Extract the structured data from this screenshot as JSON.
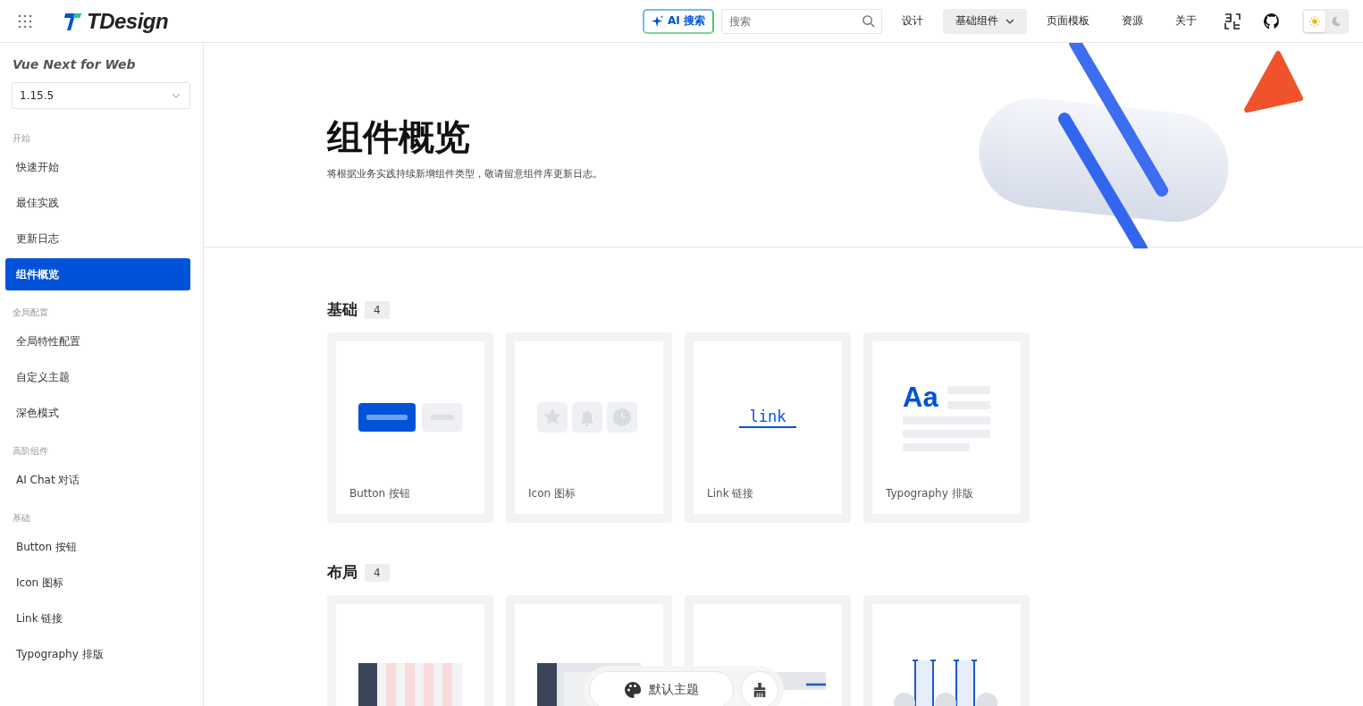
{
  "header": {
    "logo": "TDesign",
    "ai_search": "AI 搜索",
    "search": {
      "placeholder": "搜索"
    },
    "nav": [
      {
        "label": "设计",
        "selected": false,
        "dropdown": false
      },
      {
        "label": "基础组件",
        "selected": true,
        "dropdown": true
      },
      {
        "label": "页面模板",
        "selected": false,
        "dropdown": false
      },
      {
        "label": "资源",
        "selected": false,
        "dropdown": false
      },
      {
        "label": "关于",
        "selected": false,
        "dropdown": false
      }
    ],
    "theme_modes": [
      {
        "kind": "light",
        "selected": true
      },
      {
        "kind": "dark",
        "selected": false
      }
    ]
  },
  "sidebar": {
    "title": "Vue Next for Web",
    "version": "1.15.5",
    "groups": [
      {
        "title": "开始",
        "items": [
          {
            "label": "快速开始",
            "selected": false
          },
          {
            "label": "最佳实践",
            "selected": false
          },
          {
            "label": "更新日志",
            "selected": false
          },
          {
            "label": "组件概览",
            "selected": true
          }
        ]
      },
      {
        "title": "全局配置",
        "items": [
          {
            "label": "全局特性配置",
            "selected": false
          },
          {
            "label": "自定义主题",
            "selected": false
          },
          {
            "label": "深色模式",
            "selected": false
          }
        ]
      },
      {
        "title": "高阶组件",
        "items": [
          {
            "label": "AI Chat 对话",
            "selected": false
          }
        ]
      },
      {
        "title": "基础",
        "items": [
          {
            "label": "Button 按钮",
            "selected": false
          },
          {
            "label": "Icon 图标",
            "selected": false
          },
          {
            "label": "Link 链接",
            "selected": false
          },
          {
            "label": "Typography 排版",
            "selected": false
          }
        ]
      }
    ]
  },
  "hero": {
    "title": "组件概览",
    "subtitle": "将根据业务实践持续新增组件类型，敬请留意组件库更新日志。"
  },
  "sections": [
    {
      "title": "基础",
      "count": "4",
      "cards": [
        {
          "kind": "button",
          "label": "Button 按钮"
        },
        {
          "kind": "icon",
          "label": "Icon 图标"
        },
        {
          "kind": "link",
          "label": "Link 链接",
          "preview_text": "link"
        },
        {
          "kind": "typography",
          "label": "Typography 排版",
          "preview_text": "Aa"
        }
      ]
    },
    {
      "title": "布局",
      "count": "4",
      "cards": [
        {
          "kind": "grid"
        },
        {
          "kind": "layout"
        },
        {
          "kind": "divider"
        },
        {
          "kind": "space"
        }
      ]
    }
  ],
  "theme_pill": {
    "label": "默认主题"
  }
}
